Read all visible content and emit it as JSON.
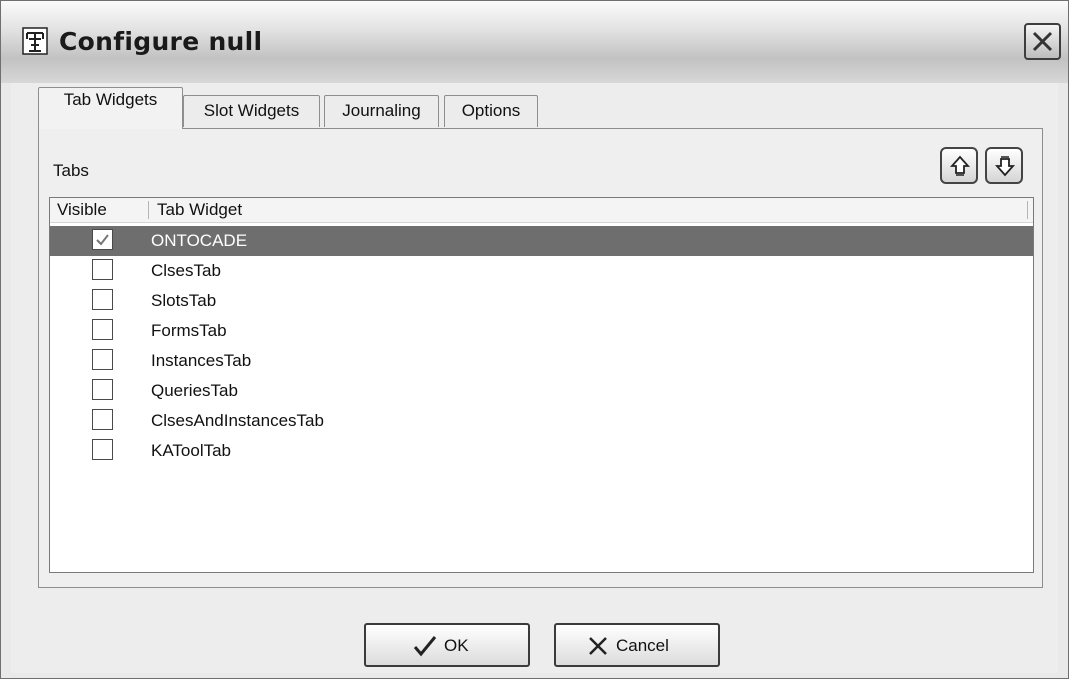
{
  "window": {
    "title": "Configure null",
    "icon": "protege-logo-icon",
    "close_icon": "close-icon"
  },
  "tabs": [
    {
      "label": "Tab Widgets",
      "active": true
    },
    {
      "label": "Slot Widgets",
      "active": false
    },
    {
      "label": "Journaling",
      "active": false
    },
    {
      "label": "Options",
      "active": false
    }
  ],
  "panel": {
    "section_label": "Tabs",
    "move_up_icon": "move-up-icon",
    "move_down_icon": "move-down-icon"
  },
  "table": {
    "columns": [
      "Visible",
      "Tab Widget"
    ],
    "rows": [
      {
        "visible": true,
        "name": "ONTOCADE",
        "selected": true
      },
      {
        "visible": false,
        "name": "ClsesTab",
        "selected": false
      },
      {
        "visible": false,
        "name": "SlotsTab",
        "selected": false
      },
      {
        "visible": false,
        "name": "FormsTab",
        "selected": false
      },
      {
        "visible": false,
        "name": "InstancesTab",
        "selected": false
      },
      {
        "visible": false,
        "name": "QueriesTab",
        "selected": false
      },
      {
        "visible": false,
        "name": "ClsesAndInstancesTab",
        "selected": false
      },
      {
        "visible": false,
        "name": "KAToolTab",
        "selected": false
      }
    ]
  },
  "footer": {
    "ok_label": "OK",
    "cancel_label": "Cancel",
    "ok_icon": "checkmark-icon",
    "cancel_icon": "x-icon"
  },
  "colors": {
    "selection": "#6e6e6e",
    "window_bg": "#ededed"
  }
}
